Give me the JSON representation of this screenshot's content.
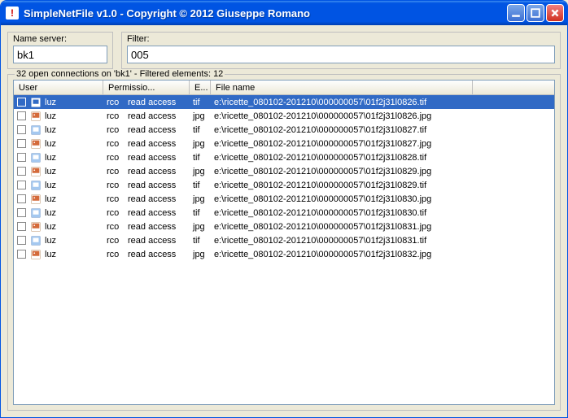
{
  "window": {
    "title": "SimpleNetFile v1.0 - Copyright © 2012 Giuseppe Romano",
    "icon_glyph": "!"
  },
  "fields": {
    "name_server_label": "Name server:",
    "name_server_value": "bk1",
    "filter_label": "Filter:",
    "filter_value": "005"
  },
  "status": "32 open connections on 'bk1' - Filtered elements: 12",
  "columns": {
    "user": "User",
    "permission": "Permissio...",
    "ext": "E...",
    "filename": "File name"
  },
  "rows": [
    {
      "selected": true,
      "ext": "tif",
      "user": "luz",
      "user2": "rco",
      "perm": "read access",
      "file": "e:\\ricette_080102-201210\\000000057\\01f2j31l0826.tif"
    },
    {
      "selected": false,
      "ext": "jpg",
      "user": "luz",
      "user2": "rco",
      "perm": "read access",
      "file": "e:\\ricette_080102-201210\\000000057\\01f2j31l0826.jpg"
    },
    {
      "selected": false,
      "ext": "tif",
      "user": "luz",
      "user2": "rco",
      "perm": "read access",
      "file": "e:\\ricette_080102-201210\\000000057\\01f2j31l0827.tif"
    },
    {
      "selected": false,
      "ext": "jpg",
      "user": "luz",
      "user2": "rco",
      "perm": "read access",
      "file": "e:\\ricette_080102-201210\\000000057\\01f2j31l0827.jpg"
    },
    {
      "selected": false,
      "ext": "tif",
      "user": "luz",
      "user2": "rco",
      "perm": "read access",
      "file": "e:\\ricette_080102-201210\\000000057\\01f2j31l0828.tif"
    },
    {
      "selected": false,
      "ext": "jpg",
      "user": "luz",
      "user2": "rco",
      "perm": "read access",
      "file": "e:\\ricette_080102-201210\\000000057\\01f2j31l0829.jpg"
    },
    {
      "selected": false,
      "ext": "tif",
      "user": "luz",
      "user2": "rco",
      "perm": "read access",
      "file": "e:\\ricette_080102-201210\\000000057\\01f2j31l0829.tif"
    },
    {
      "selected": false,
      "ext": "jpg",
      "user": "luz",
      "user2": "rco",
      "perm": "read access",
      "file": "e:\\ricette_080102-201210\\000000057\\01f2j31l0830.jpg"
    },
    {
      "selected": false,
      "ext": "tif",
      "user": "luz",
      "user2": "rco",
      "perm": "read access",
      "file": "e:\\ricette_080102-201210\\000000057\\01f2j31l0830.tif"
    },
    {
      "selected": false,
      "ext": "jpg",
      "user": "luz",
      "user2": "rco",
      "perm": "read access",
      "file": "e:\\ricette_080102-201210\\000000057\\01f2j31l0831.jpg"
    },
    {
      "selected": false,
      "ext": "tif",
      "user": "luz",
      "user2": "rco",
      "perm": "read access",
      "file": "e:\\ricette_080102-201210\\000000057\\01f2j31l0831.tif"
    },
    {
      "selected": false,
      "ext": "jpg",
      "user": "luz",
      "user2": "rco",
      "perm": "read access",
      "file": "e:\\ricette_080102-201210\\000000057\\01f2j31l0832.jpg"
    }
  ]
}
